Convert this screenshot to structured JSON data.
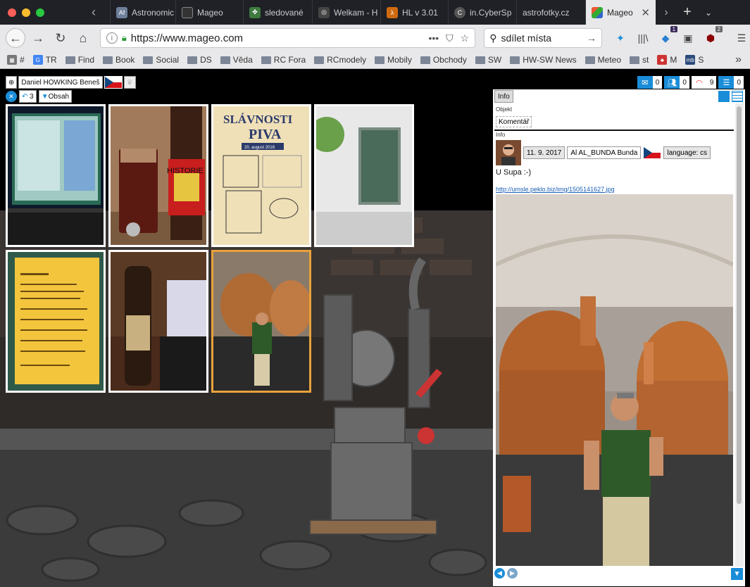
{
  "tabs": [
    {
      "label": "Astronomic",
      "icon": "af-icon",
      "color": "#6e7f9a"
    },
    {
      "label": "Mageo",
      "icon": "mageo-icon",
      "color": "#333333"
    },
    {
      "label": "sledované",
      "icon": "clover-icon",
      "color": "#3f7a3f"
    },
    {
      "label": "Welkam - H",
      "icon": "saturn-icon",
      "color": "#444444"
    },
    {
      "label": "HL v 3.01",
      "icon": "hl-icon",
      "color": "#d06a10"
    },
    {
      "label": "in.CyberSp",
      "icon": "cyber-icon",
      "color": "#555555"
    },
    {
      "label": "astrofotky.cz",
      "icon": "",
      "color": "#1f2126"
    },
    {
      "label": "Mageo",
      "icon": "mageo-color-icon",
      "color": "#c0392b"
    }
  ],
  "address": {
    "url": "https://www.mageo.com",
    "search": "sdílet místa"
  },
  "toolbar_badges": {
    "sync": "1",
    "ublock": "2"
  },
  "bookmarks": [
    {
      "label": "#",
      "icon": "img"
    },
    {
      "label": "TR",
      "icon": "g"
    },
    {
      "label": "Find",
      "icon": "folder"
    },
    {
      "label": "Book",
      "icon": "folder"
    },
    {
      "label": "Social",
      "icon": "folder"
    },
    {
      "label": "DS",
      "icon": "folder"
    },
    {
      "label": "Věda",
      "icon": "folder"
    },
    {
      "label": "RC Fora",
      "icon": "folder"
    },
    {
      "label": "RCmodely",
      "icon": "folder"
    },
    {
      "label": "Mobily",
      "icon": "folder"
    },
    {
      "label": "Obchody",
      "icon": "folder"
    },
    {
      "label": "SW",
      "icon": "folder"
    },
    {
      "label": "HW-SW News",
      "icon": "folder"
    },
    {
      "label": "Meteo",
      "icon": "folder"
    },
    {
      "label": "st",
      "icon": "folder"
    },
    {
      "label": "M",
      "icon": "m"
    },
    {
      "label": "S",
      "icon": "mb"
    }
  ],
  "profile": {
    "name": "Daniel HOWKING Beneš",
    "replies": "3",
    "contents": "Obsah"
  },
  "counters": {
    "mail": "0",
    "people": "0",
    "wifi": "9",
    "list": "0"
  },
  "panel": {
    "tab": "Info",
    "object_label": "Objekt",
    "object_value": "Komentář",
    "info_label": "Info",
    "date": "11. 9. 2017",
    "author": "Al AL_BUNDA Bunda",
    "language": "language: cs",
    "comment": "U Supa :-)",
    "link": "http://umsle.peklo.biz/img/1505141627.jpg"
  },
  "poster": {
    "title1": "SLÁVNOSTI",
    "title2": "PIVA",
    "date": "20. august 2016"
  },
  "beer_label": "HISTORIE"
}
